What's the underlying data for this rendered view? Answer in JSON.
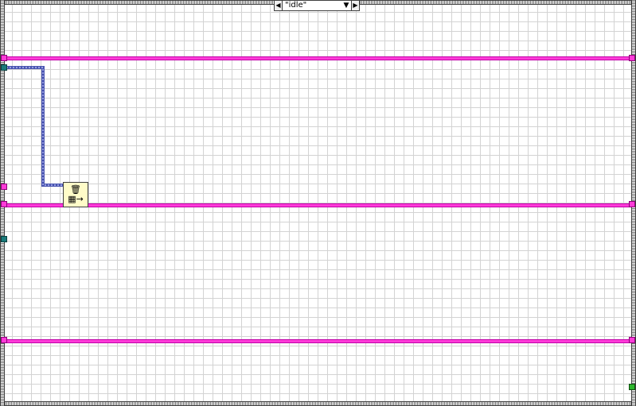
{
  "case_structure": {
    "selector_value": "\"idle\"",
    "decrement_icon": "triangle-left",
    "increment_icon": "triangle-right",
    "dropdown_icon": "triangle-down"
  },
  "nodes": {
    "delete_from_map": {
      "top_icon": "trash-can-icon",
      "bottom_icon": "map-arrow-icon"
    }
  },
  "colors": {
    "cluster_wire": "#ff3cd8",
    "reference_wire": "#4a55b0",
    "refnum_tunnel": "#1a7a7a",
    "bool_tunnel": "#2db52d",
    "node_background": "#fffcc8"
  }
}
